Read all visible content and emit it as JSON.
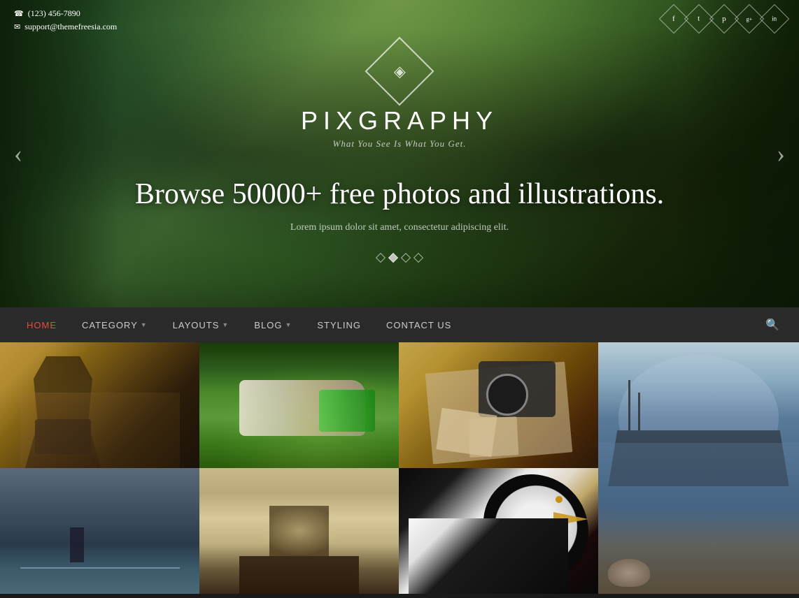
{
  "site": {
    "title": "PIXGRAPHY",
    "tagline": "What You See Is What You Get.",
    "logo_symbol": "◈"
  },
  "contact_info": {
    "phone": "(123) 456-7890",
    "email": "support@themefreesia.com",
    "phone_icon": "☎",
    "email_icon": "✉"
  },
  "social": {
    "icons": [
      {
        "name": "facebook",
        "symbol": "f"
      },
      {
        "name": "twitter",
        "symbol": "t"
      },
      {
        "name": "pinterest",
        "symbol": "p"
      },
      {
        "name": "google-plus",
        "symbol": "g+"
      },
      {
        "name": "instagram",
        "symbol": "in"
      }
    ]
  },
  "hero": {
    "headline": "Browse 50000+ free photos and illustrations.",
    "subtext": "Lorem ipsum dolor sit amet, consectetur adipiscing elit.",
    "dots": [
      {
        "active": false
      },
      {
        "active": true
      },
      {
        "active": false
      },
      {
        "active": false
      }
    ]
  },
  "nav": {
    "items": [
      {
        "label": "HOME",
        "active": true,
        "has_dropdown": false
      },
      {
        "label": "CATEGORY",
        "active": false,
        "has_dropdown": true
      },
      {
        "label": "LAYOUTS",
        "active": false,
        "has_dropdown": true
      },
      {
        "label": "BLOG",
        "active": false,
        "has_dropdown": true
      },
      {
        "label": "STYLING",
        "active": false,
        "has_dropdown": false
      },
      {
        "label": "CONTACT US",
        "active": false,
        "has_dropdown": false
      }
    ],
    "search_icon": "🔍"
  },
  "photos": {
    "grid": [
      {
        "id": 1,
        "alt": "Photographer with camera",
        "row": 1,
        "col": 1
      },
      {
        "id": 2,
        "alt": "Sneakers on grass",
        "row": 1,
        "col": 2
      },
      {
        "id": 3,
        "alt": "Camera and map on table",
        "row": 1,
        "col": 3
      },
      {
        "id": 4,
        "alt": "Ship in stormy sea",
        "row": 1,
        "col": 4,
        "rowspan": 2
      },
      {
        "id": 5,
        "alt": "Person by sea",
        "row": 2,
        "col": 1
      },
      {
        "id": 6,
        "alt": "Pier in sepia",
        "row": 2,
        "col": 2
      },
      {
        "id": 7,
        "alt": "Bald eagle",
        "row": 2,
        "col": 3
      }
    ]
  }
}
